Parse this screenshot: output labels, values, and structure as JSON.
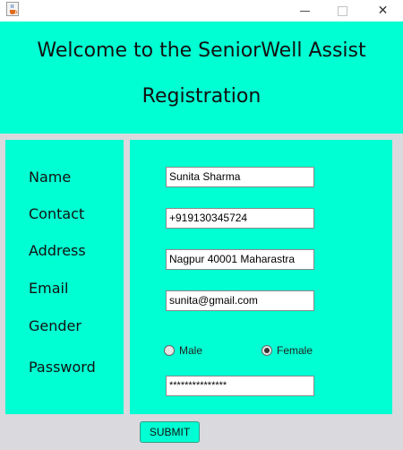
{
  "window": {
    "app_icon": "java-cup-icon",
    "minimize_icon": "minimize-icon",
    "maximize_icon": "maximize-icon",
    "close_icon": "close-icon",
    "minimize_glyph": "—",
    "maximize_glyph": "□",
    "close_glyph": "✕"
  },
  "header": {
    "line1": "Welcome to the SeniorWell Assist",
    "line2": "Registration",
    "background": "#00ffd2"
  },
  "labels": {
    "name": "Name",
    "contact": "Contact",
    "address": "Address",
    "email": "Email",
    "gender": "Gender",
    "password": "Password"
  },
  "fields": {
    "name": "Sunita Sharma",
    "contact": "+919130345724",
    "address": "Nagpur 40001 Maharastra",
    "email": "sunita@gmail.com",
    "password": "***************"
  },
  "gender_options": {
    "male": "Male",
    "female": "Female",
    "selected": "Female"
  },
  "submit_label": "SUBMIT"
}
